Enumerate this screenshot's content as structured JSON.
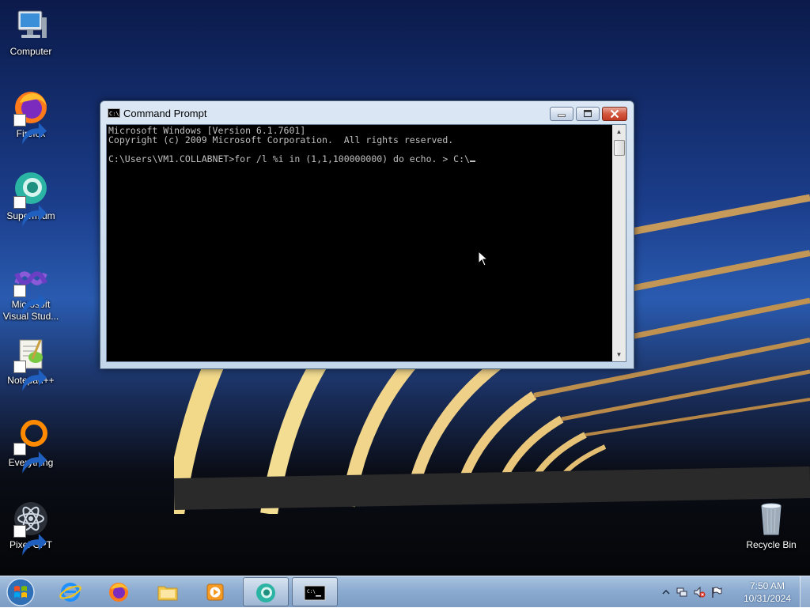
{
  "desktop_icons": [
    {
      "label": "Computer",
      "icon": "computer-icon"
    },
    {
      "label": "Firefox",
      "icon": "firefox-icon"
    },
    {
      "label": "Supermium",
      "icon": "supermium-icon"
    },
    {
      "label": "Microsoft Visual Stud...",
      "icon": "visual-studio-icon"
    },
    {
      "label": "Notepad++",
      "icon": "notepadpp-icon"
    },
    {
      "label": "Everything",
      "icon": "everything-icon"
    },
    {
      "label": "Pixel GPT",
      "icon": "pixel-gpt-icon"
    },
    {
      "label": "Recycle Bin",
      "icon": "recycle-bin-icon"
    }
  ],
  "cmd_window": {
    "title": "Command Prompt",
    "icon_text": "C:\\",
    "lines": [
      "Microsoft Windows [Version 6.1.7601]",
      "Copyright (c) 2009 Microsoft Corporation.  All rights reserved.",
      "",
      "C:\\Users\\VM1.COLLABNET>for /l %i in (1,1,100000000) do echo. > C:\\"
    ]
  },
  "taskbar": {
    "pinned": [
      {
        "name": "internet-explorer",
        "icon": "internet-explorer-icon"
      },
      {
        "name": "firefox",
        "icon": "firefox-icon"
      },
      {
        "name": "file-explorer",
        "icon": "folder-icon"
      },
      {
        "name": "media-player",
        "icon": "media-player-icon"
      },
      {
        "name": "supermium",
        "icon": "supermium-icon"
      },
      {
        "name": "command-prompt",
        "icon": "cmd-icon"
      }
    ],
    "time": "7:50 AM",
    "date": "10/31/2024"
  },
  "colors": {
    "console_bg": "#000000",
    "console_fg": "#c0c0c0",
    "close_button": "#c13b22"
  }
}
